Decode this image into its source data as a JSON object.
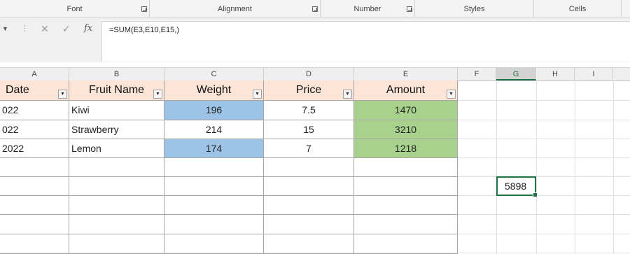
{
  "ribbon": {
    "groups": [
      "Font",
      "Alignment",
      "Number",
      "Styles",
      "Cells"
    ]
  },
  "formula_bar": {
    "formula": "=SUM(E3,E10,E15,)",
    "fx_label": "fx",
    "cancel_icon": "cancel-icon",
    "enter_icon": "check-icon"
  },
  "columns": [
    "A",
    "B",
    "C",
    "D",
    "E",
    "F",
    "G",
    "H",
    "I"
  ],
  "selected_column": "G",
  "table": {
    "headers": [
      "Date",
      "Fruit Name",
      "Weight",
      "Price",
      "Amount"
    ],
    "rows": [
      {
        "date": "022",
        "fruit": "Kiwi",
        "weight": "196",
        "price": "7.5",
        "amount": "1470"
      },
      {
        "date": "022",
        "fruit": "Strawberry",
        "weight": "214",
        "price": "15",
        "amount": "3210"
      },
      {
        "date": "2022",
        "fruit": "Lemon",
        "weight": "174",
        "price": "7",
        "amount": "1218"
      }
    ]
  },
  "result_cell": {
    "value": "5898"
  },
  "colors": {
    "header_fill": "#fce4d6",
    "weight_highlight": "#9dc3e6",
    "amount_fill": "#a9d18e",
    "selection": "#217346"
  }
}
